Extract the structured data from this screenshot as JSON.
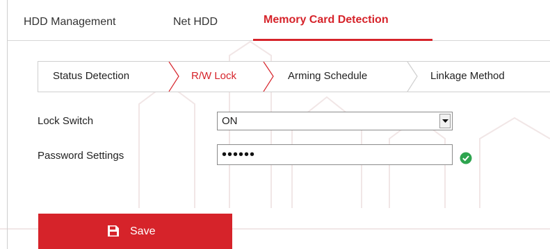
{
  "main_tabs": [
    {
      "label": "HDD Management",
      "active": false
    },
    {
      "label": "Net HDD",
      "active": false
    },
    {
      "label": "Memory Card Detection",
      "active": true
    }
  ],
  "sub_tabs": [
    {
      "label": "Status Detection",
      "active": false
    },
    {
      "label": "R/W Lock",
      "active": true
    },
    {
      "label": "Arming Schedule",
      "active": false
    },
    {
      "label": "Linkage Method",
      "active": false
    }
  ],
  "form": {
    "lock_switch": {
      "label": "Lock Switch",
      "value": "ON"
    },
    "password": {
      "label": "Password Settings",
      "value": "••••••",
      "valid": true
    }
  },
  "save_label": "Save",
  "colors": {
    "accent": "#d6232a",
    "valid": "#2ea44f",
    "border": "#cfcfcf"
  },
  "icons": {
    "save": "floppy-disk-icon",
    "valid": "check-circle-icon",
    "dropdown": "chevron-down-icon"
  }
}
